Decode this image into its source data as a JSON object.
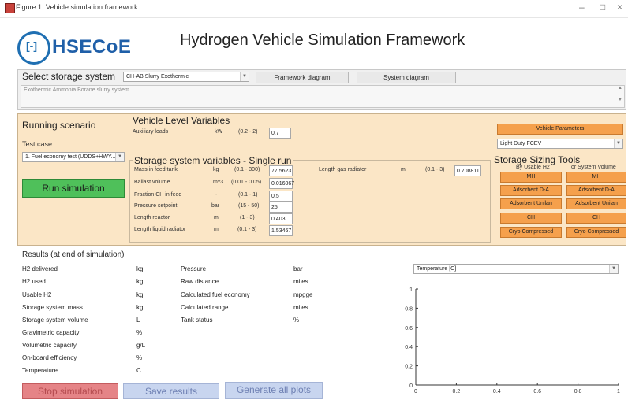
{
  "window": {
    "title": "Figure 1: Vehicle simulation framework"
  },
  "header": {
    "logo_text": "HSECoE",
    "logo_mark": "[-]",
    "title": "Hydrogen Vehicle Simulation Framework"
  },
  "storage": {
    "label": "Select storage system",
    "selected": "CH-AB Slurry Exothermic",
    "framework_btn": "Framework diagram",
    "system_btn": "System diagram",
    "description": "Exothermic Ammonia Borane slurry system"
  },
  "scenario": {
    "title": "Running scenario",
    "test_case_label": "Test case",
    "test_case_value": "1. Fuel economy test (UDDS+HWY...",
    "run_btn": "Run simulation"
  },
  "vehicle_vars": {
    "title": "Vehicle Level Variables",
    "rows": [
      {
        "name": "Auxiliary loads",
        "unit": "kW",
        "range": "(0.2 - 2)",
        "value": "0.7"
      }
    ]
  },
  "storage_vars": {
    "title": "Storage system variables - Single run",
    "rows": [
      {
        "name": "Mass in feed tank",
        "unit": "kg",
        "range": "(0.1 - 300)",
        "value": "77.5623"
      },
      {
        "name": "Ballast volume",
        "unit": "m^3",
        "range": "(0.01 - 0.05)",
        "value": "0.016067"
      },
      {
        "name": "Fraction CH in feed",
        "unit": "-",
        "range": "(0.1 - 1)",
        "value": "0.5"
      },
      {
        "name": "Pressure setpoint",
        "unit": "bar",
        "range": "(15 - 50)",
        "value": "25"
      },
      {
        "name": "Length reactor",
        "unit": "m",
        "range": "(1 - 3)",
        "value": "0.403"
      },
      {
        "name": "Length liquid radiator",
        "unit": "m",
        "range": "(0.1 - 3)",
        "value": "1.53467"
      }
    ],
    "gas_radiator": {
      "name": "Length gas radiator",
      "unit": "m",
      "range": "(0.1 - 3)",
      "value": "0.708811"
    }
  },
  "vehicle_params": {
    "btn": "Vehicle Parameters",
    "selected": "Light Duty FCEV"
  },
  "sizing": {
    "title": "Storage Sizing Tools",
    "col1": "By Usable H2",
    "col2": "or System Volume",
    "buttons": [
      "MH",
      "Adsorbent D-A",
      "Adsorbent Unilan",
      "CH",
      "Cryo Compressed"
    ]
  },
  "results": {
    "title": "Results (at end of simulation)",
    "left": [
      {
        "name": "H2 delivered",
        "unit": "kg"
      },
      {
        "name": "H2 used",
        "unit": "kg"
      },
      {
        "name": "Usable H2",
        "unit": "kg"
      },
      {
        "name": "Storage system mass",
        "unit": "kg"
      },
      {
        "name": "Storage system volume",
        "unit": "L"
      },
      {
        "name": "Gravimetric capacity",
        "unit": "%"
      },
      {
        "name": "Volumetric capacity",
        "unit": "g/L"
      },
      {
        "name": "On-board efficiency",
        "unit": "%"
      },
      {
        "name": "Temperature",
        "unit": "C"
      }
    ],
    "right": [
      {
        "name": "Pressure",
        "unit": "bar"
      },
      {
        "name": "Raw distance",
        "unit": "miles"
      },
      {
        "name": "Calculated fuel economy",
        "unit": "mpgge"
      },
      {
        "name": "Calculated range",
        "unit": "miles"
      },
      {
        "name": "Tank status",
        "unit": "%"
      }
    ],
    "stop_btn": "Stop simulation",
    "save_btn": "Save results",
    "gen_btn": "Generate all plots"
  },
  "plot": {
    "selected": "Temperature [C]",
    "xticks": [
      "0",
      "0.2",
      "0.4",
      "0.6",
      "0.8",
      "1"
    ],
    "yticks": [
      "0",
      "0.2",
      "0.4",
      "0.6",
      "0.8",
      "1"
    ]
  },
  "chart_data": {
    "type": "line",
    "series": [],
    "xlim": [
      0,
      1
    ],
    "ylim": [
      0,
      1
    ]
  }
}
